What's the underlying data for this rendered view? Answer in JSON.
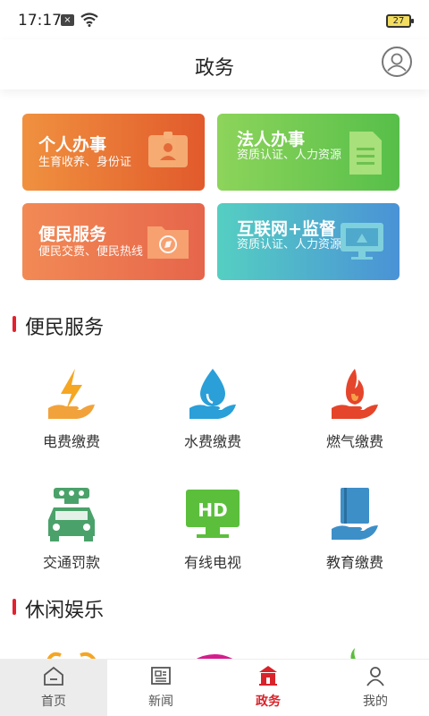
{
  "status": {
    "time": "17:17",
    "notif_badge": "×",
    "battery": "27"
  },
  "header": {
    "title": "政务"
  },
  "cards": [
    {
      "title": "个人办事",
      "subtitle": "生育收养、身份证"
    },
    {
      "title": "法人办事",
      "subtitle": "资质认证、人力资源"
    },
    {
      "title": "便民服务",
      "subtitle": "便民交费、便民热线"
    },
    {
      "title": "互联网+监督",
      "subtitle": "资质认证、人力资源"
    }
  ],
  "sections": {
    "services": "便民服务",
    "leisure": "休闲娱乐"
  },
  "services": [
    {
      "label": "电费缴费",
      "icon": "electricity-icon"
    },
    {
      "label": "水费缴费",
      "icon": "water-icon"
    },
    {
      "label": "燃气缴费",
      "icon": "gas-icon"
    },
    {
      "label": "交通罚款",
      "icon": "traffic-fine-icon"
    },
    {
      "label": "有线电视",
      "icon": "cable-tv-icon",
      "badge": "HD"
    },
    {
      "label": "教育缴费",
      "icon": "education-icon"
    }
  ],
  "tabs": [
    {
      "label": "首页",
      "icon": "home-icon"
    },
    {
      "label": "新闻",
      "icon": "news-icon"
    },
    {
      "label": "政务",
      "icon": "government-icon",
      "active": true
    },
    {
      "label": "我的",
      "icon": "profile-icon"
    }
  ],
  "colors": {
    "accent": "#d9232b",
    "section_bar": "#e3212e"
  }
}
